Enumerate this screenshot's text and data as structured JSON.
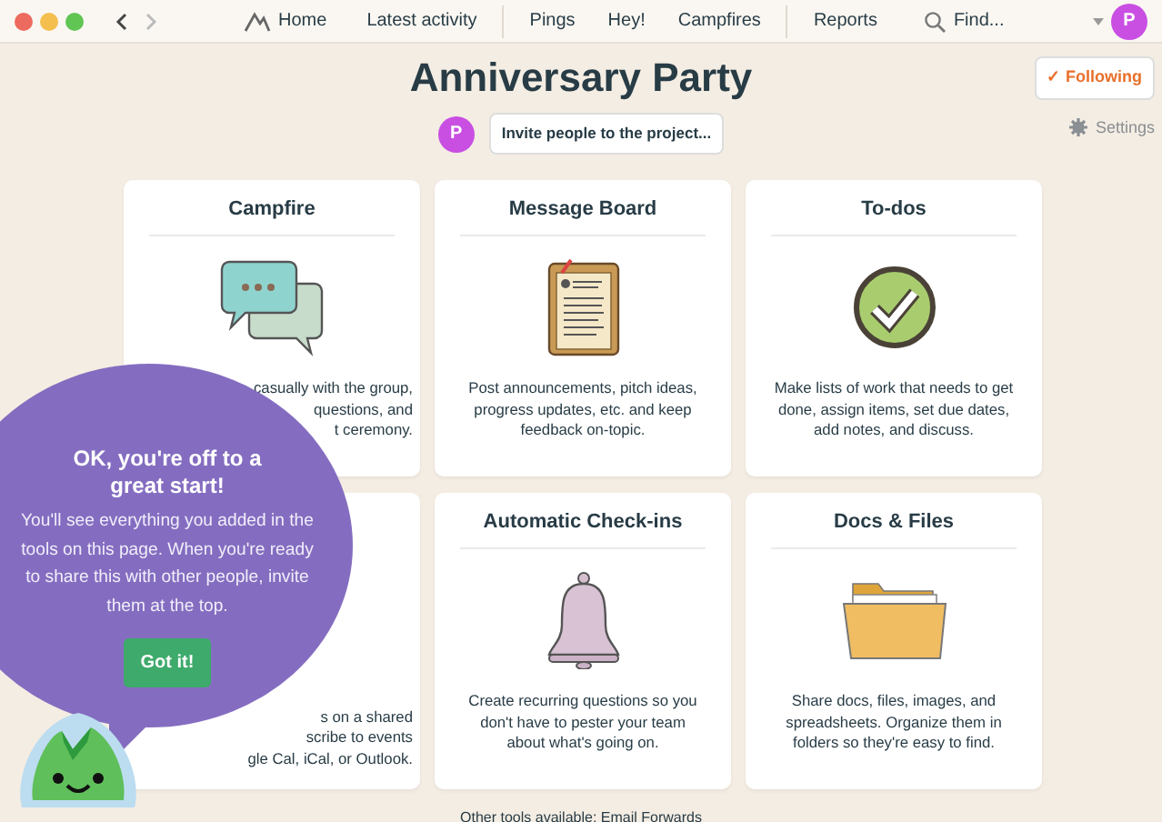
{
  "nav": {
    "groups": [
      [
        {
          "kind": "home",
          "label": "Home"
        },
        {
          "kind": "link",
          "label": "Latest activity"
        }
      ],
      [
        {
          "kind": "link",
          "label": "Pings"
        },
        {
          "kind": "link",
          "label": "Hey!"
        },
        {
          "kind": "link",
          "label": "Campfires"
        }
      ],
      [
        {
          "kind": "link",
          "label": "Reports"
        },
        {
          "kind": "search",
          "label": "Find..."
        }
      ]
    ],
    "avatar": "P"
  },
  "project": {
    "title": "Anniversary Party",
    "avatar": "P",
    "invite": "Invite people to the project...",
    "following": {
      "mark": "✓",
      "label": "Following"
    },
    "settings": "Settings"
  },
  "tools": [
    {
      "kind": "chat",
      "title": "Campfire",
      "fragments": [
        "casually with the group,",
        "questions, and",
        "t ceremony."
      ]
    },
    {
      "kind": "clipboard",
      "title": "Message Board",
      "description": "Post announcements, pitch ideas, progress updates, etc. and keep feedback on-topic."
    },
    {
      "kind": "check",
      "title": "To-dos",
      "description": "Make lists of work that needs to get done, assign items, set due dates, add notes, and discuss."
    },
    {
      "kind": "hidden",
      "fragments": [
        "s on a shared",
        "scribe to events",
        "gle Cal, iCal, or Outlook."
      ]
    },
    {
      "kind": "bell",
      "title": "Automatic Check-ins",
      "description": "Create recurring questions so you don't have to pester your team about what's going on."
    },
    {
      "kind": "folder",
      "title": "Docs & Files",
      "description": "Share docs, files, images, and spreadsheets. Organize them in folders so they're easy to find."
    }
  ],
  "footer": "Other tools available: Email Forwards",
  "onboarding": {
    "heading": "OK, you're off to a great start!",
    "body": "You'll see everything you added in the tools on this page. When you're ready to share this with other people, invite them at the top.",
    "button": "Got it!"
  }
}
